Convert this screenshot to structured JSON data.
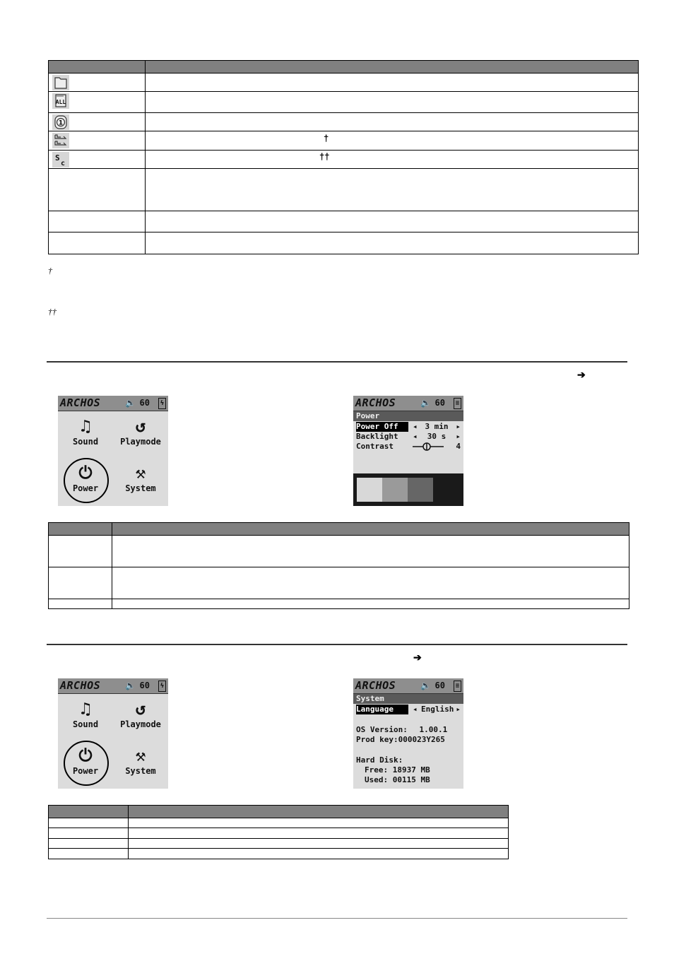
{
  "page": {
    "type": "manual-page"
  },
  "top_table": {
    "header": [
      "",
      ""
    ],
    "rows": [
      {
        "icon": "folder-icon",
        "icon_glyph": "🗀",
        "label": "",
        "desc": "",
        "dagger": ""
      },
      {
        "icon": "all-repeat-icon",
        "icon_glyph": "ALL",
        "label": "",
        "desc": "",
        "dagger": ""
      },
      {
        "icon": "single-repeat-icon",
        "icon_glyph": "①",
        "label": "",
        "desc": "",
        "dagger": ""
      },
      {
        "icon": "queue-icon",
        "icon_glyph": "⤓",
        "label": "",
        "desc": "",
        "dagger": "†"
      },
      {
        "icon": "scan-icon",
        "icon_glyph": "Sc",
        "label": "",
        "desc": "",
        "dagger": "††"
      },
      {
        "icon": "",
        "icon_glyph": "",
        "label": "",
        "desc": "",
        "dagger": ""
      },
      {
        "icon": "",
        "icon_glyph": "",
        "label": "",
        "desc": "",
        "dagger": ""
      },
      {
        "icon": "",
        "icon_glyph": "",
        "label": "",
        "desc": "",
        "dagger": ""
      }
    ]
  },
  "footnotes": [
    {
      "mark": "†",
      "text": ""
    },
    {
      "mark": "††",
      "text": ""
    }
  ],
  "power_section": {
    "heading": "",
    "arrow": "➔",
    "main_menu_screen": {
      "brand": "ARCHOS",
      "volume": "60",
      "battery_glyph": "ϟ",
      "items": [
        {
          "label": "Sound",
          "glyph": "♫"
        },
        {
          "label": "Playmode",
          "glyph": "↺"
        },
        {
          "label": "Power",
          "glyph": "⏻"
        },
        {
          "label": "System",
          "glyph": "⚒"
        }
      ],
      "highlighted": "Power"
    },
    "settings_screen": {
      "brand": "ARCHOS",
      "volume": "60",
      "title": "Power",
      "rows": [
        {
          "label": "Power Off",
          "value": "3 min",
          "selected": true
        },
        {
          "label": "Backlight",
          "value": "30 s",
          "selected": false
        },
        {
          "label": "Contrast",
          "value": "4",
          "selected": false
        }
      ],
      "contrast_level": 4,
      "swatches": [
        "#d8d8d8",
        "#9a9a9a",
        "#666666"
      ]
    },
    "table": {
      "header": [
        "",
        ""
      ],
      "rows": [
        {
          "label": "",
          "desc": ""
        },
        {
          "label": "",
          "desc": ""
        },
        {
          "label": "",
          "desc": ""
        }
      ]
    }
  },
  "system_section": {
    "heading": "",
    "arrow": "➔",
    "main_menu_screen": {
      "brand": "ARCHOS",
      "volume": "60",
      "battery_glyph": "ϟ",
      "items": [
        {
          "label": "Sound",
          "glyph": "♫"
        },
        {
          "label": "Playmode",
          "glyph": "↺"
        },
        {
          "label": "Power",
          "glyph": "⏻"
        },
        {
          "label": "System",
          "glyph": "⚒"
        }
      ],
      "highlighted": "Power"
    },
    "settings_screen": {
      "brand": "ARCHOS",
      "volume": "60",
      "title": "System",
      "language_label": "Language",
      "language_value": "English",
      "os_version_label": "OS Version:",
      "os_version": "1.00.1",
      "prod_key_label": "Prod key:",
      "prod_key": "000023Y265",
      "hard_disk_label": "Hard Disk:",
      "free_label": "Free:",
      "free_value": "18937 MB",
      "used_label": "Used:",
      "used_value": "00115 MB"
    },
    "table": {
      "header": [
        "",
        ""
      ],
      "rows": [
        {
          "label": "",
          "desc": ""
        },
        {
          "label": "",
          "desc": ""
        },
        {
          "label": "",
          "desc": ""
        },
        {
          "label": "",
          "desc": ""
        }
      ]
    }
  }
}
